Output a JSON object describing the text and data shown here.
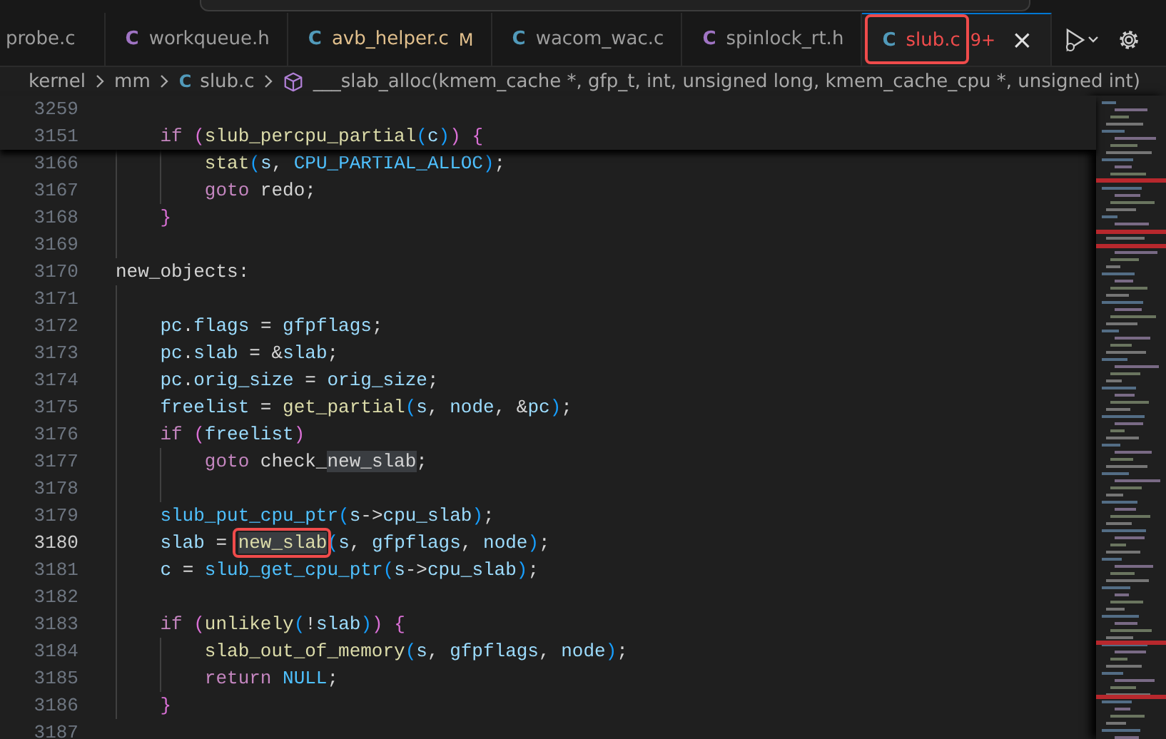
{
  "tabs": [
    {
      "label": "probe.c",
      "modified": false,
      "errors": false,
      "selected": false,
      "annotated": false
    },
    {
      "icon": "C",
      "color": "#a074c4",
      "label": "workqueue.h",
      "modified": false,
      "errors": false,
      "selected": false,
      "annotated": false
    },
    {
      "icon": "C",
      "color": "#519aba",
      "label": "avb_helper.c",
      "modified": true,
      "errors": false,
      "badge": "M",
      "selected": false,
      "annotated": false
    },
    {
      "icon": "C",
      "color": "#519aba",
      "label": "wacom_wac.c",
      "modified": false,
      "errors": false,
      "selected": false,
      "annotated": false
    },
    {
      "icon": "C",
      "color": "#a074c4",
      "label": "spinlock_rt.h",
      "modified": false,
      "errors": false,
      "selected": false,
      "annotated": false
    },
    {
      "icon": "C",
      "color": "#519aba",
      "label": "slub.c",
      "modified": false,
      "errors": true,
      "badge": "9+",
      "selected": true,
      "annotated": true,
      "close": "×"
    }
  ],
  "breadcrumb": [
    {
      "kind": "folder",
      "label": "kernel"
    },
    {
      "kind": "folder",
      "label": "mm"
    },
    {
      "kind": "file",
      "icon": "C",
      "color": "#519aba",
      "label": "slub.c"
    },
    {
      "kind": "symbol",
      "label": "___slab_alloc(kmem_cache *, gfp_t, int, unsigned long, kmem_cache_cpu *, unsigned int)"
    }
  ],
  "sticky_lines": [
    {
      "number": "3259",
      "current": false
    },
    {
      "number": "3151",
      "current": false,
      "tokens": [
        {
          "t": "    if",
          "kind": "kw"
        },
        {
          "t": " (",
          "kind": "b1"
        },
        {
          "t": "slub_percpu_partial",
          "kind": "fn"
        },
        {
          "t": "(",
          "kind": "b2"
        },
        {
          "t": "c",
          "kind": "var"
        },
        {
          "t": ")",
          "kind": "b2"
        },
        {
          "t": ")",
          "kind": "b1"
        },
        {
          "t": " {",
          "kind": "b1"
        }
      ]
    }
  ],
  "lines": [
    {
      "number": "3166",
      "current": false,
      "tokens": [
        {
          "t": "        stat",
          "kind": "fn"
        },
        {
          "t": "(",
          "kind": "b2"
        },
        {
          "t": "s",
          "kind": "var"
        },
        {
          "t": ", ",
          "kind": "plain"
        },
        {
          "t": "CPU_PARTIAL_ALLOC",
          "kind": "const"
        },
        {
          "t": ")",
          "kind": "b2"
        },
        {
          "t": ";",
          "kind": "plain"
        }
      ]
    },
    {
      "number": "3167",
      "current": false,
      "tokens": [
        {
          "t": "        goto",
          "kind": "kw"
        },
        {
          "t": " redo;",
          "kind": "plain"
        }
      ]
    },
    {
      "number": "3168",
      "current": false,
      "tokens": [
        {
          "t": "    }",
          "kind": "b1"
        }
      ]
    },
    {
      "number": "3169",
      "current": false
    },
    {
      "number": "3170",
      "current": false,
      "tokens": [
        {
          "t": "new_objects:",
          "kind": "plain"
        }
      ]
    },
    {
      "number": "3171",
      "current": false
    },
    {
      "number": "3172",
      "current": false,
      "tokens": [
        {
          "t": "    pc",
          "kind": "var"
        },
        {
          "t": ".",
          "kind": "plain"
        },
        {
          "t": "flags",
          "kind": "var"
        },
        {
          "t": " = ",
          "kind": "plain"
        },
        {
          "t": "gfpflags",
          "kind": "var"
        },
        {
          "t": ";",
          "kind": "plain"
        }
      ]
    },
    {
      "number": "3173",
      "current": false,
      "tokens": [
        {
          "t": "    pc",
          "kind": "var"
        },
        {
          "t": ".",
          "kind": "plain"
        },
        {
          "t": "slab",
          "kind": "var"
        },
        {
          "t": " = &",
          "kind": "plain"
        },
        {
          "t": "slab",
          "kind": "var"
        },
        {
          "t": ";",
          "kind": "plain"
        }
      ]
    },
    {
      "number": "3174",
      "current": false,
      "tokens": [
        {
          "t": "    pc",
          "kind": "var"
        },
        {
          "t": ".",
          "kind": "plain"
        },
        {
          "t": "orig_size",
          "kind": "var"
        },
        {
          "t": " = ",
          "kind": "plain"
        },
        {
          "t": "orig_size",
          "kind": "var"
        },
        {
          "t": ";",
          "kind": "plain"
        }
      ]
    },
    {
      "number": "3175",
      "current": false,
      "tokens": [
        {
          "t": "    freelist",
          "kind": "var"
        },
        {
          "t": " = ",
          "kind": "plain"
        },
        {
          "t": "get_partial",
          "kind": "fn"
        },
        {
          "t": "(",
          "kind": "b2"
        },
        {
          "t": "s",
          "kind": "var"
        },
        {
          "t": ", ",
          "kind": "plain"
        },
        {
          "t": "node",
          "kind": "var"
        },
        {
          "t": ", &",
          "kind": "plain"
        },
        {
          "t": "pc",
          "kind": "var"
        },
        {
          "t": ")",
          "kind": "b2"
        },
        {
          "t": ";",
          "kind": "plain"
        }
      ]
    },
    {
      "number": "3176",
      "current": false,
      "tokens": [
        {
          "t": "    if",
          "kind": "kw"
        },
        {
          "t": " (",
          "kind": "b1"
        },
        {
          "t": "freelist",
          "kind": "var"
        },
        {
          "t": ")",
          "kind": "b1"
        }
      ]
    },
    {
      "number": "3177",
      "current": false,
      "tokens": [
        {
          "t": "        goto",
          "kind": "kw"
        },
        {
          "t": " check_",
          "kind": "plain"
        },
        {
          "t": "new_slab",
          "kind": "plain",
          "highlighted": true
        },
        {
          "t": ";",
          "kind": "plain"
        }
      ]
    },
    {
      "number": "3178",
      "current": false
    },
    {
      "number": "3179",
      "current": false,
      "tokens": [
        {
          "t": "    slub_put_cpu_ptr",
          "kind": "macro"
        },
        {
          "t": "(",
          "kind": "b2"
        },
        {
          "t": "s",
          "kind": "var"
        },
        {
          "t": "->",
          "kind": "plain"
        },
        {
          "t": "cpu_slab",
          "kind": "var"
        },
        {
          "t": ")",
          "kind": "b2"
        },
        {
          "t": ";",
          "kind": "plain"
        }
      ]
    },
    {
      "number": "3180",
      "current": true,
      "tokens": [
        {
          "t": "    slab",
          "kind": "var"
        },
        {
          "t": " = ",
          "kind": "plain"
        },
        {
          "t": "new_slab",
          "kind": "fn",
          "highlighted": true,
          "boxed": true
        },
        {
          "t": "(",
          "kind": "b2"
        },
        {
          "t": "s",
          "kind": "var"
        },
        {
          "t": ", ",
          "kind": "plain"
        },
        {
          "t": "gfpflags",
          "kind": "var"
        },
        {
          "t": ", ",
          "kind": "plain"
        },
        {
          "t": "node",
          "kind": "var"
        },
        {
          "t": ")",
          "kind": "b2"
        },
        {
          "t": ";",
          "kind": "plain"
        }
      ]
    },
    {
      "number": "3181",
      "current": false,
      "tokens": [
        {
          "t": "    c",
          "kind": "var"
        },
        {
          "t": " = ",
          "kind": "plain"
        },
        {
          "t": "slub_get_cpu_ptr",
          "kind": "macro"
        },
        {
          "t": "(",
          "kind": "b2"
        },
        {
          "t": "s",
          "kind": "var"
        },
        {
          "t": "->",
          "kind": "plain"
        },
        {
          "t": "cpu_slab",
          "kind": "var"
        },
        {
          "t": ")",
          "kind": "b2"
        },
        {
          "t": ";",
          "kind": "plain"
        }
      ]
    },
    {
      "number": "3182",
      "current": false
    },
    {
      "number": "3183",
      "current": false,
      "tokens": [
        {
          "t": "    if",
          "kind": "kw"
        },
        {
          "t": " (",
          "kind": "b1"
        },
        {
          "t": "unlikely",
          "kind": "fn"
        },
        {
          "t": "(",
          "kind": "b2"
        },
        {
          "t": "!",
          "kind": "plain"
        },
        {
          "t": "slab",
          "kind": "var"
        },
        {
          "t": ")",
          "kind": "b2"
        },
        {
          "t": ")",
          "kind": "b1"
        },
        {
          "t": " {",
          "kind": "b1"
        }
      ]
    },
    {
      "number": "3184",
      "current": false,
      "tokens": [
        {
          "t": "        slab_out_of_memory",
          "kind": "fn"
        },
        {
          "t": "(",
          "kind": "b2"
        },
        {
          "t": "s",
          "kind": "var"
        },
        {
          "t": ", ",
          "kind": "plain"
        },
        {
          "t": "gfpflags",
          "kind": "var"
        },
        {
          "t": ", ",
          "kind": "plain"
        },
        {
          "t": "node",
          "kind": "var"
        },
        {
          "t": ")",
          "kind": "b2"
        },
        {
          "t": ";",
          "kind": "plain"
        }
      ]
    },
    {
      "number": "3185",
      "current": false,
      "tokens": [
        {
          "t": "        return",
          "kind": "kw"
        },
        {
          "t": " NULL",
          "kind": "const"
        },
        {
          "t": ";",
          "kind": "plain"
        }
      ]
    },
    {
      "number": "3186",
      "current": false,
      "tokens": [
        {
          "t": "    }",
          "kind": "b1"
        }
      ]
    },
    {
      "number": "3187",
      "current": false
    }
  ]
}
